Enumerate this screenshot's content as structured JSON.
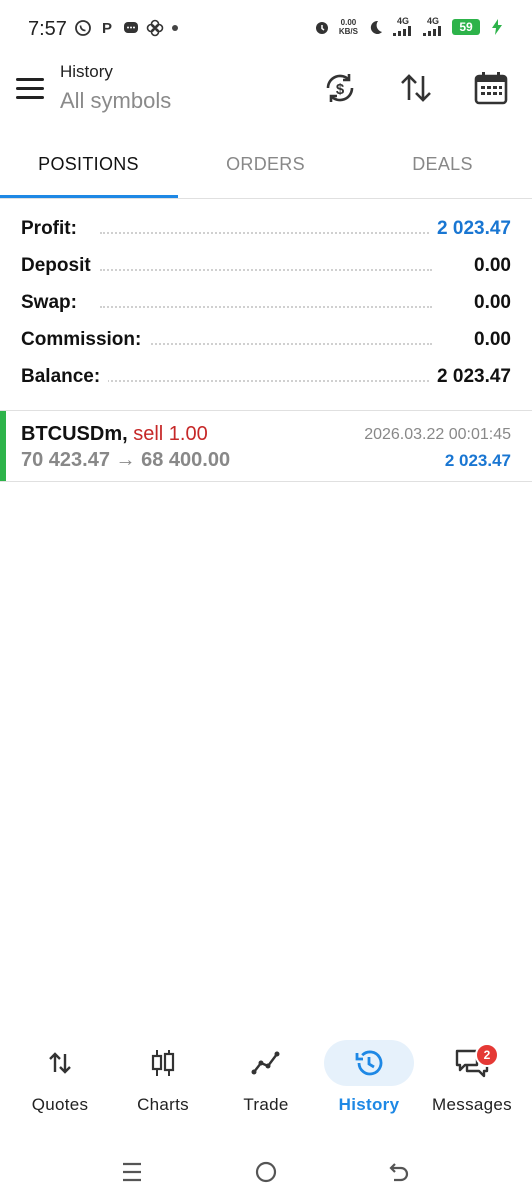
{
  "status_bar": {
    "time": "7:57",
    "speed_value": "0.00",
    "speed_unit": "KB/S",
    "net1": "4G",
    "net2": "4G",
    "battery": "59"
  },
  "app_bar": {
    "title": "History",
    "subtitle": "All symbols"
  },
  "tabs": [
    {
      "label": "POSITIONS",
      "active": true
    },
    {
      "label": "ORDERS",
      "active": false
    },
    {
      "label": "DEALS",
      "active": false
    }
  ],
  "summary": [
    {
      "label": "Profit:",
      "value": "2 023.47",
      "highlight": true
    },
    {
      "label": "Deposit",
      "value": "0.00",
      "highlight": false
    },
    {
      "label": "Swap:",
      "value": "0.00",
      "highlight": false
    },
    {
      "label": "Commission:",
      "value": "0.00",
      "highlight": false
    },
    {
      "label": "Balance:",
      "value": "2 023.47",
      "highlight": false
    }
  ],
  "positions": [
    {
      "symbol": "BTCUSDm,",
      "type": "sell 1.00",
      "datetime": "2026.03.22 00:01:45",
      "prices": "70 423.47 → 68 400.00",
      "profit": "2 023.47"
    }
  ],
  "bottom_nav": [
    {
      "label": "Quotes",
      "icon": "quotes-arrows-icon",
      "active": false
    },
    {
      "label": "Charts",
      "icon": "candlestick-icon",
      "active": false
    },
    {
      "label": "Trade",
      "icon": "trade-line-icon",
      "active": false
    },
    {
      "label": "History",
      "icon": "history-clock-icon",
      "active": true
    },
    {
      "label": "Messages",
      "icon": "messages-icon",
      "active": false,
      "badge": "2"
    }
  ],
  "colors": {
    "accent": "#1e88e5",
    "profit": "#1976d2",
    "sell": "#c62828",
    "position_bar": "#2db34a"
  }
}
